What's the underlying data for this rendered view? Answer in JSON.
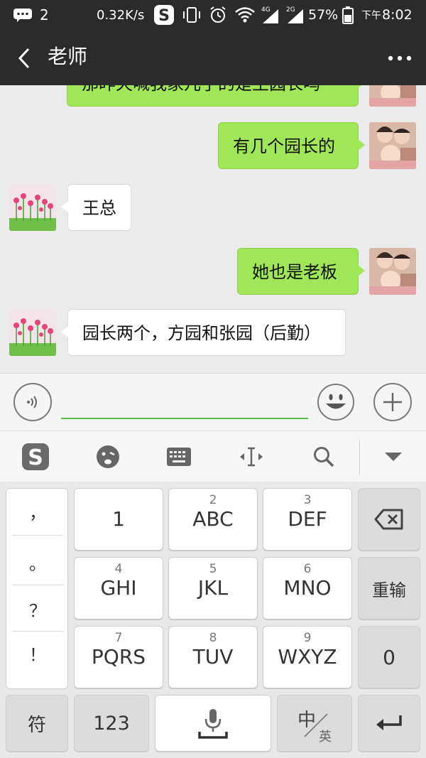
{
  "status_bar": {
    "notification_count": "2",
    "net_speed": "0.32K/s",
    "network_4g": "4G",
    "network_2g": "2G",
    "battery_percent": "57%",
    "time_period": "下午",
    "time": "8:02"
  },
  "title_bar": {
    "title": "老师"
  },
  "messages": [
    {
      "side": "right",
      "text": "那昨天喊我家儿子的是王园长吗"
    },
    {
      "side": "right",
      "text": "有几个园长的"
    },
    {
      "side": "left",
      "text": "王总"
    },
    {
      "side": "right",
      "text": "她也是老板"
    },
    {
      "side": "left",
      "text": "园长两个，方园和张园（后勤）"
    }
  ],
  "input": {
    "value": "",
    "placeholder": ""
  },
  "keyboard": {
    "punctuation": [
      "，",
      "。",
      "？",
      "！"
    ],
    "keys": [
      {
        "num": "",
        "letters": "1"
      },
      {
        "num": "2",
        "letters": "ABC"
      },
      {
        "num": "3",
        "letters": "DEF"
      },
      {
        "num": "4",
        "letters": "GHI"
      },
      {
        "num": "5",
        "letters": "JKL"
      },
      {
        "num": "6",
        "letters": "MNO"
      },
      {
        "num": "7",
        "letters": "PQRS"
      },
      {
        "num": "8",
        "letters": "TUV"
      },
      {
        "num": "9",
        "letters": "WXYZ"
      }
    ],
    "retype_label": "重输",
    "zero_label": "0",
    "symbol_label": "符",
    "numeric_label": "123",
    "lang_main": "中",
    "lang_alt": "英"
  },
  "colors": {
    "header_bg": "#2b2b2b",
    "bubble_sent": "#9fe658",
    "bubble_received": "#ffffff",
    "input_underline": "#5bbd4a"
  },
  "icons": {
    "toolbar": [
      "sogou-logo-icon",
      "emoji-face-icon",
      "keyboard-icon",
      "cursor-move-icon",
      "search-icon",
      "collapse-down-icon"
    ]
  }
}
